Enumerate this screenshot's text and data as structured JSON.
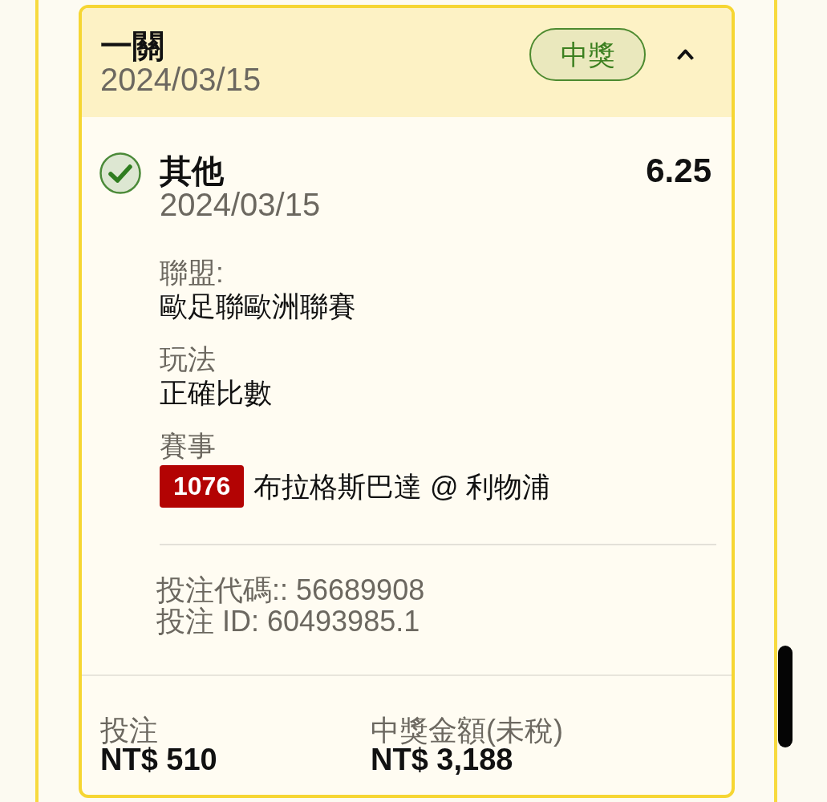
{
  "bet": {
    "title": "一關",
    "date": "2024/03/15",
    "status": "中獎",
    "expanded": true
  },
  "selection": {
    "won": true,
    "title": "其他",
    "date": "2024/03/15",
    "odds": "6.25",
    "details": [
      {
        "kind": "text",
        "label": "聯盟:",
        "value": "歐足聯歐洲聯賽"
      },
      {
        "kind": "text",
        "label": "玩法",
        "value": "正確比數"
      },
      {
        "kind": "match",
        "label": "賽事",
        "match_number": "1076",
        "value": "布拉格斯巴達 @ 利物浦"
      }
    ],
    "references": [
      "投注代碼:: 56689908",
      "投注 ID: 60493985.1"
    ]
  },
  "totals": [
    {
      "label": "投注",
      "amount": "NT$ 510"
    },
    {
      "label": "中獎金額(未稅)",
      "amount": "NT$ 3,188"
    }
  ]
}
